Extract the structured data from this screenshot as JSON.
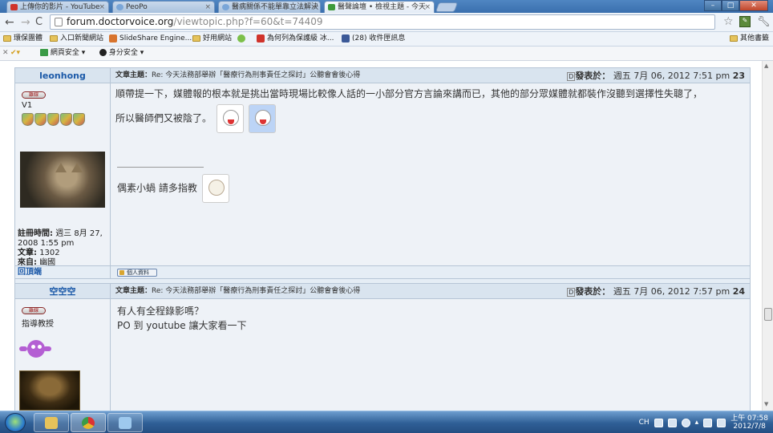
{
  "browser": {
    "tabs": [
      {
        "label": "上傳你的影片 - YouTube",
        "icon_color": "#d0332b"
      },
      {
        "label": "PeoPo",
        "icon_color": "#7aa6d8"
      },
      {
        "label": "醫病關係不能單靠立法解決",
        "icon_color": "#7aa6d8"
      },
      {
        "label": "醫聲論壇 • 檢視主題 - 今天",
        "icon_color": "#3e9a3a"
      }
    ],
    "url_host": "forum.doctorvoice.org",
    "url_path": "/viewtopic.php?f=60&t=74409",
    "bookmarks": [
      {
        "label": "環保團體"
      },
      {
        "label": "入口新聞網站"
      },
      {
        "label": "SlideShare Engine..."
      },
      {
        "label": "好用網站"
      },
      {
        "label": "為何列為保護級 冰..."
      },
      {
        "label": "(28) 收件匣訊息"
      }
    ],
    "bookmarks_other": "其他書籤",
    "toolbar_items": [
      "網頁安全 ▾",
      "身分安全 ▾"
    ]
  },
  "posts": [
    {
      "author": "leonhong",
      "status_badge": "離線",
      "rank": "V1",
      "subject_label": "文章主題：",
      "subject": "Re: 今天法務部舉辦「醫療行為刑事責任之探討」公聽會會後心得",
      "posted_label": "發表於：",
      "posted_at": "週五 7月 06, 2012 7:51 pm",
      "post_number": "23",
      "body_line1": "順帶提一下，媒體報的根本就是挑出當時現場比較像人話的一小部分官方言論來講而已，其他的部分眾媒體就都裝作沒聽到選擇性失聰了，",
      "body_line2": "所以醫師們又被陰了。",
      "signature": "偶素小蝸 請多指教",
      "registered_label": "註冊時間:",
      "registered": "週三 8月 27, 2008 1:55 pm",
      "posts_label": "文章:",
      "posts_count": "1302",
      "from_label": "來自:",
      "from": "幽國",
      "back_top": "回頂端",
      "profile_button": "個人資料"
    },
    {
      "author": "空空空",
      "status_badge": "離線",
      "rank": "指導教授",
      "subject_label": "文章主題：",
      "subject": "Re: 今天法務部舉辦「醫療行為刑事責任之探討」公聽會會後心得",
      "posted_label": "發表於：",
      "posted_at": "週五 7月 06, 2012 7:57 pm",
      "post_number": "24",
      "body_line1": "有人有全程錄影嗎？",
      "body_line2": "PO 到 youtube 讓大家看一下"
    }
  ],
  "taskbar": {
    "ime": "CH",
    "time": "上午 07:58",
    "date": "2012/7/8"
  }
}
